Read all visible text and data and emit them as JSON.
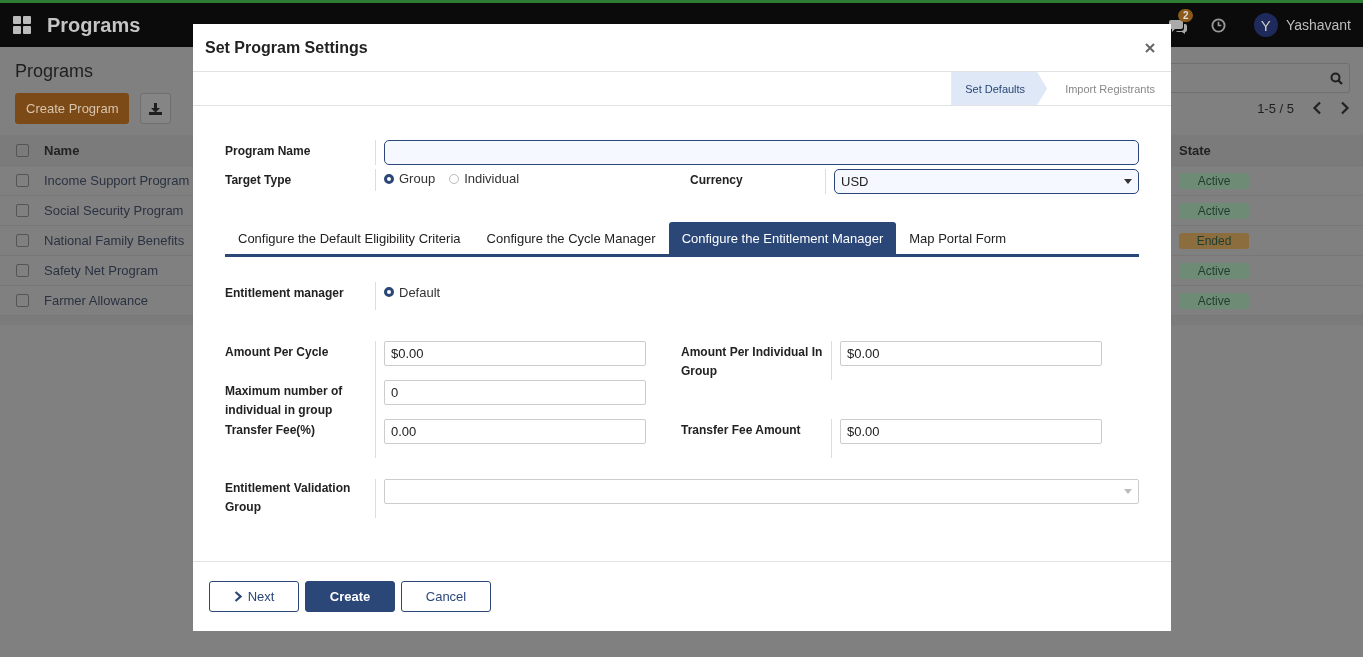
{
  "navbar": {
    "app_title": "Programs",
    "messages_count": "2",
    "user": {
      "initial": "Y",
      "name": "Yashavant"
    }
  },
  "page": {
    "title": "Programs",
    "create_button": "Create Program",
    "pager": "1-5 / 5"
  },
  "table": {
    "columns": [
      "Name",
      "State"
    ],
    "select_all_checked": false,
    "rows": [
      {
        "checked": false,
        "name": "Income Support Program",
        "state": "Active",
        "color": "#6e8c75"
      },
      {
        "checked": false,
        "name": "Social Security Program",
        "state": "Active",
        "color": "#6e8c75"
      },
      {
        "checked": false,
        "name": "National Family Benefits",
        "state": "Ended",
        "color": "#8c6d3d"
      },
      {
        "checked": false,
        "name": "Safety Net Program",
        "state": "Active",
        "color": "#6e8c75"
      },
      {
        "checked": false,
        "name": "Farmer Allowance",
        "state": "Active",
        "color": "#6e8c75"
      }
    ]
  },
  "dialog": {
    "title": "Set Program Settings",
    "steps": [
      {
        "label": "Set Defaults",
        "selected": true
      },
      {
        "label": "Import Registrants",
        "selected": false
      }
    ],
    "program_name": {
      "label": "Program Name"
    },
    "target_type": {
      "label": "Target Type",
      "options": [
        {
          "label": "Group",
          "selected": true
        },
        {
          "label": "Individual",
          "selected": false
        }
      ]
    },
    "currency": {
      "label": "Currency",
      "value": "USD"
    },
    "tabs": [
      {
        "label": "Configure the Default Eligibility Criteria",
        "selected": false
      },
      {
        "label": "Configure the Cycle Manager",
        "selected": false
      },
      {
        "label": "Configure the Entitlement Manager",
        "selected": true
      },
      {
        "label": "Map Portal Form",
        "selected": false
      }
    ],
    "entitlement_manager": {
      "label": "Entitlement manager",
      "options": [
        {
          "label": "Default",
          "selected": true
        }
      ]
    },
    "left_fields": [
      {
        "label": "Amount Per Cycle",
        "value": "$0.00"
      },
      {
        "label": "Maximum number of individual in group",
        "value": "0"
      },
      {
        "label": "Transfer Fee(%)",
        "value": "0.00"
      }
    ],
    "right_fields": [
      {
        "label": "Amount Per Individual In Group",
        "value": "$0.00"
      },
      {
        "label": "Transfer Fee Amount",
        "value": "$0.00"
      }
    ],
    "validation_group": {
      "label": "Entitlement Validation Group"
    },
    "buttons": [
      {
        "label": "Next",
        "kind": "next"
      },
      {
        "label": "Create",
        "kind": "primary"
      },
      {
        "label": "Cancel",
        "kind": "secondary"
      }
    ]
  }
}
